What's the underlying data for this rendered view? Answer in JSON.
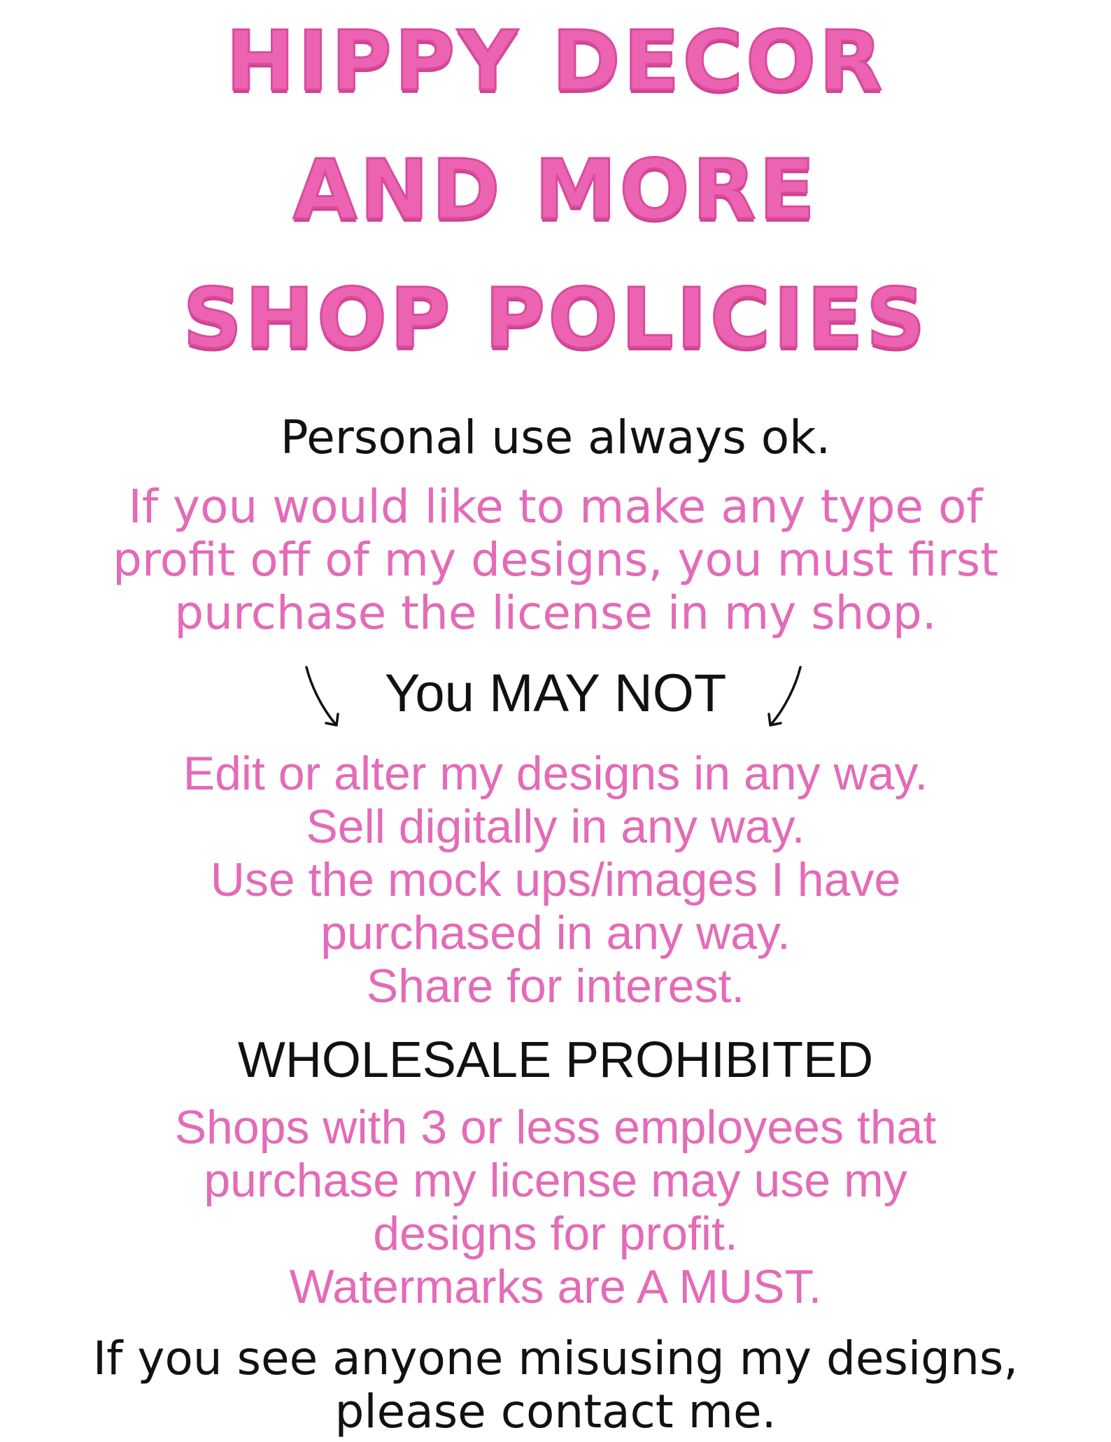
{
  "title": {
    "line1": "HIPPY DECOR",
    "line2": "AND MORE",
    "line3": "SHOP POLICIES"
  },
  "personal_use": "Personal use always ok.",
  "license_notice": [
    "If you would like to make any type of",
    "profit off of my designs, you must first",
    "purchase the license in my shop."
  ],
  "may_not_heading": "You MAY NOT",
  "may_not_items": [
    "Edit or alter my designs in any way.",
    "Sell digitally in any way.",
    "Use the mock ups/images I have",
    "purchased in any way.",
    "Share for interest."
  ],
  "wholesale_heading": "WHOLESALE PROHIBITED",
  "wholesale_notice": [
    "Shops with 3 or less employees that",
    "purchase my license may use my",
    "designs for profit.",
    "Watermarks are A MUST."
  ],
  "contact_notice": [
    "If you see anyone misusing my designs,",
    "please contact me."
  ],
  "colors": {
    "title_pink": "#ec63b2",
    "text_pink": "#e36bb7",
    "text_black": "#111111",
    "background": "#ffffff"
  },
  "icons": [
    "arrow-down-left-icon",
    "arrow-down-right-icon"
  ]
}
